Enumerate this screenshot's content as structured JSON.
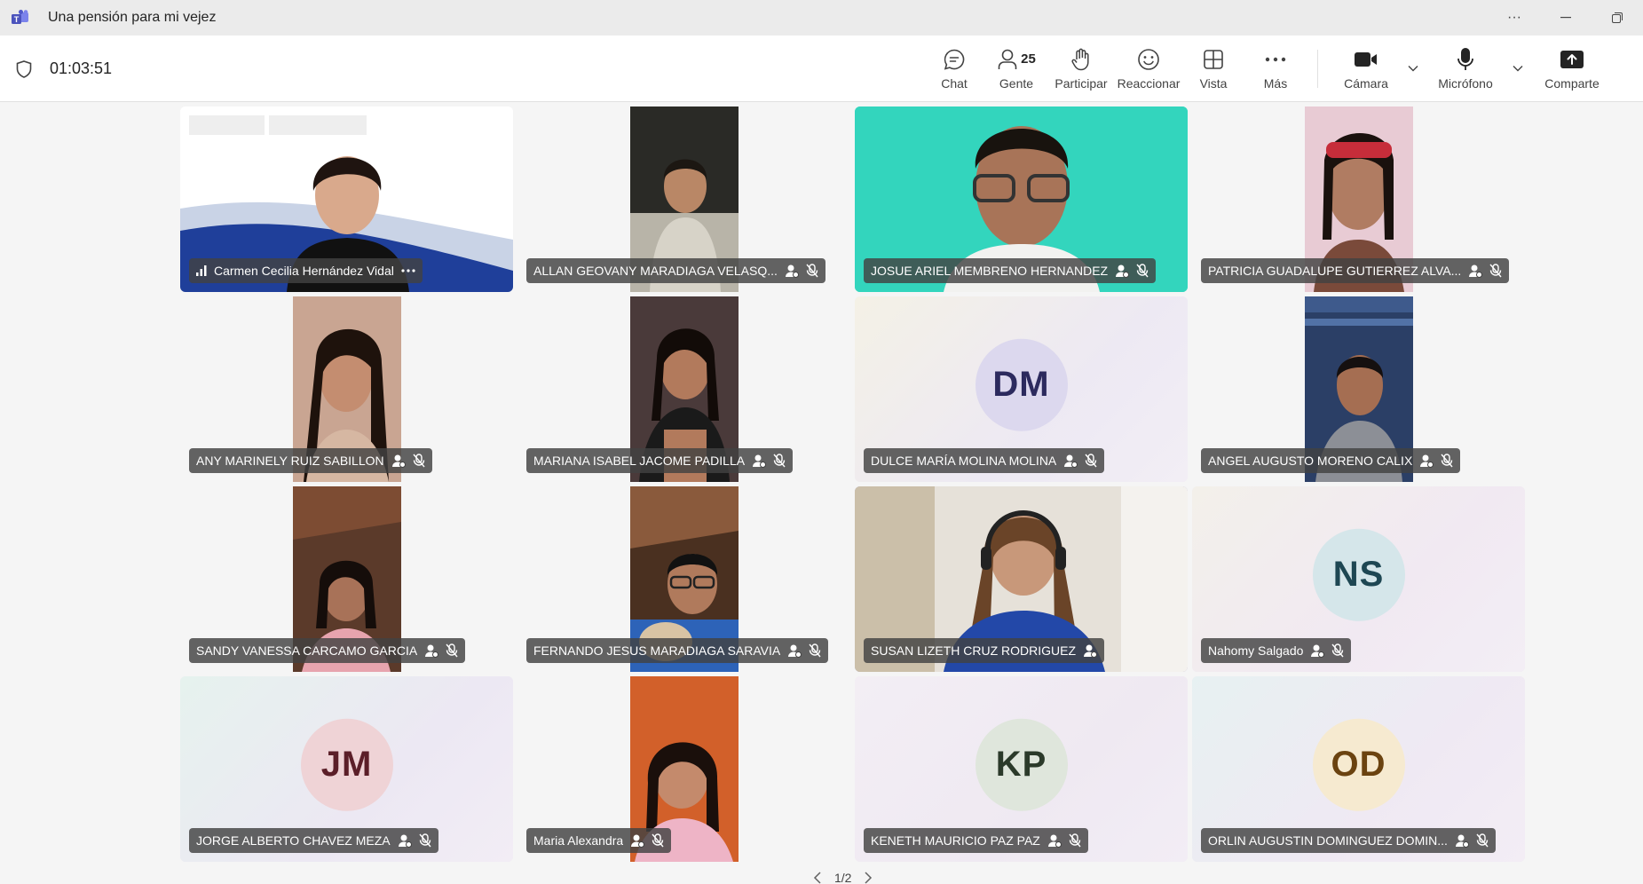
{
  "window": {
    "title": "Una pensión para mi vejez",
    "more": "···"
  },
  "meeting": {
    "timer": "01:03:51"
  },
  "toolbar": {
    "chat": "Chat",
    "people_label": "Gente",
    "people_count": "25",
    "raise": "Participar",
    "react": "Reaccionar",
    "view": "Vista",
    "more": "Más",
    "camera": "Cámara",
    "mic": "Micrófono",
    "share": "Comparte"
  },
  "participants": [
    {
      "name": "Carmen Cecilia Hernández Vidal",
      "type": "video"
    },
    {
      "name": "ALLAN GEOVANY MARADIAGA VELASQ...",
      "type": "video"
    },
    {
      "name": "JOSUE ARIEL MEMBRENO HERNANDEZ",
      "type": "video"
    },
    {
      "name": "PATRICIA GUADALUPE GUTIERREZ ALVA...",
      "type": "video"
    },
    {
      "name": "ANY MARINELY RUIZ SABILLON",
      "type": "video"
    },
    {
      "name": "MARIANA ISABEL JACOME PADILLA",
      "type": "video"
    },
    {
      "name": "DULCE MARÍA MOLINA MOLINA",
      "type": "avatar",
      "initials": "DM",
      "avatar_bg": "#dcd8ee",
      "avatar_fg": "#2c2a5e"
    },
    {
      "name": "ANGEL AUGUSTO MORENO CALIX",
      "type": "video"
    },
    {
      "name": "SANDY VANESSA CARCAMO GARCIA",
      "type": "video"
    },
    {
      "name": "FERNANDO JESUS MARADIAGA SARAVIA",
      "type": "video"
    },
    {
      "name": "SUSAN LIZETH CRUZ RODRIGUEZ",
      "type": "video"
    },
    {
      "name": "Nahomy Salgado",
      "type": "avatar",
      "initials": "NS",
      "avatar_bg": "#d5e6ea",
      "avatar_fg": "#1e4753"
    },
    {
      "name": "JORGE ALBERTO CHAVEZ MEZA",
      "type": "avatar",
      "initials": "JM",
      "avatar_bg": "#efd3d6",
      "avatar_fg": "#5b1e28"
    },
    {
      "name": "Maria Alexandra",
      "type": "video"
    },
    {
      "name": "KENETH MAURICIO PAZ PAZ",
      "type": "avatar",
      "initials": "KP",
      "avatar_bg": "#dfe6dc",
      "avatar_fg": "#2b3a2a"
    },
    {
      "name": "ORLIN AUGUSTIN DOMINGUEZ DOMIN...",
      "type": "avatar",
      "initials": "OD",
      "avatar_bg": "#f6ead0",
      "avatar_fg": "#6b4310"
    }
  ],
  "pager": {
    "page": "1/2"
  },
  "colors": {
    "accent": "#5b5fc7",
    "label_bg": "#424242"
  }
}
